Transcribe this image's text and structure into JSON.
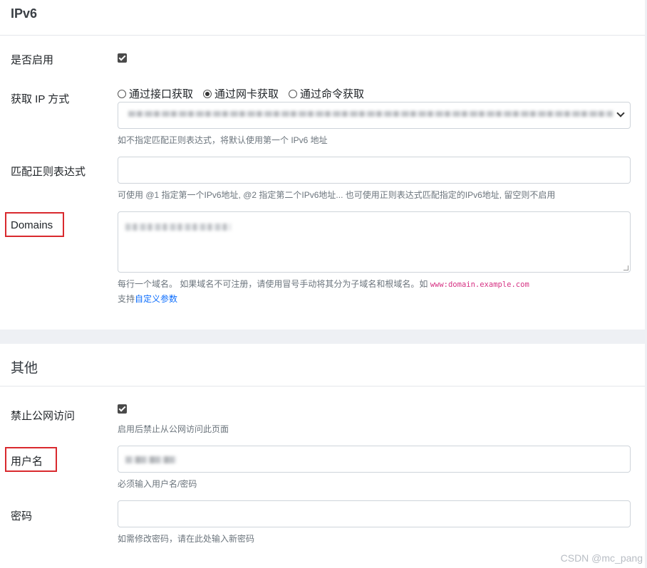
{
  "ipv6_section": {
    "title": "IPv6",
    "enable": {
      "label": "是否启用",
      "checked": true
    },
    "get_ip": {
      "label": "获取 IP 方式",
      "options": [
        "通过接口获取",
        "通过网卡获取",
        "通过命令获取"
      ],
      "selected": "通过网卡获取",
      "select_hint": "如不指定匹配正则表达式，将默认使用第一个 IPv6 地址"
    },
    "regex": {
      "label": "匹配正则表达式",
      "value": "",
      "hint": "可使用 @1 指定第一个IPv6地址, @2 指定第二个IPv6地址... 也可使用正则表达式匹配指定的IPv6地址, 留空则不启用"
    },
    "domains": {
      "label": "Domains",
      "hint_text": "每行一个域名。 如果域名不可注册，请使用冒号手动将其分为子域名和根域名。如",
      "hint_code": "www:domain.example.com",
      "support_prefix": "支持",
      "support_link": "自定义参数"
    }
  },
  "other_section": {
    "title": "其他",
    "disable_public": {
      "label": "禁止公网访问",
      "checked": true,
      "hint": "启用后禁止从公网访问此页面"
    },
    "username": {
      "label": "用户名",
      "hint": "必须输入用户名/密码"
    },
    "password": {
      "label": "密码",
      "value": "",
      "hint": "如需修改密码，请在此处输入新密码"
    }
  },
  "colors": {
    "highlight": "#d9292e",
    "link": "#0d6efd",
    "code": "#d63384"
  },
  "watermark": "CSDN @mc_pang"
}
